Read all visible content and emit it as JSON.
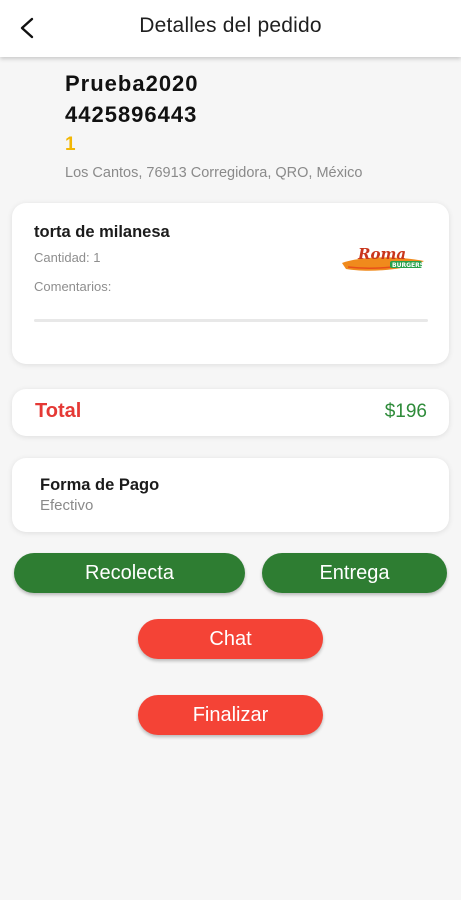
{
  "header": {
    "title": "Detalles del pedido",
    "back_icon": "back-arrow-icon"
  },
  "customer": {
    "name": "Prueba2020",
    "phone": "4425896443",
    "count": "1",
    "address": "Los Cantos, 76913 Corregidora, QRO, México"
  },
  "item": {
    "name": "torta de milanesa",
    "quantity": "Cantidad: 1",
    "comments": "Comentarios:",
    "logo_text": "Roma",
    "logo_subtext": "BURGERS"
  },
  "total": {
    "label": "Total",
    "value": "$196"
  },
  "payment": {
    "label": "Forma de Pago",
    "value": "Efectivo"
  },
  "actions": {
    "recolecta": "Recolecta",
    "entrega": "Entrega",
    "chat": "Chat",
    "finalizar": "Finalizar"
  },
  "colors": {
    "green": "#2e7d32",
    "red": "#f44336",
    "total_label": "#e53935",
    "total_value": "#2e8b3a",
    "count": "#f2b705"
  }
}
